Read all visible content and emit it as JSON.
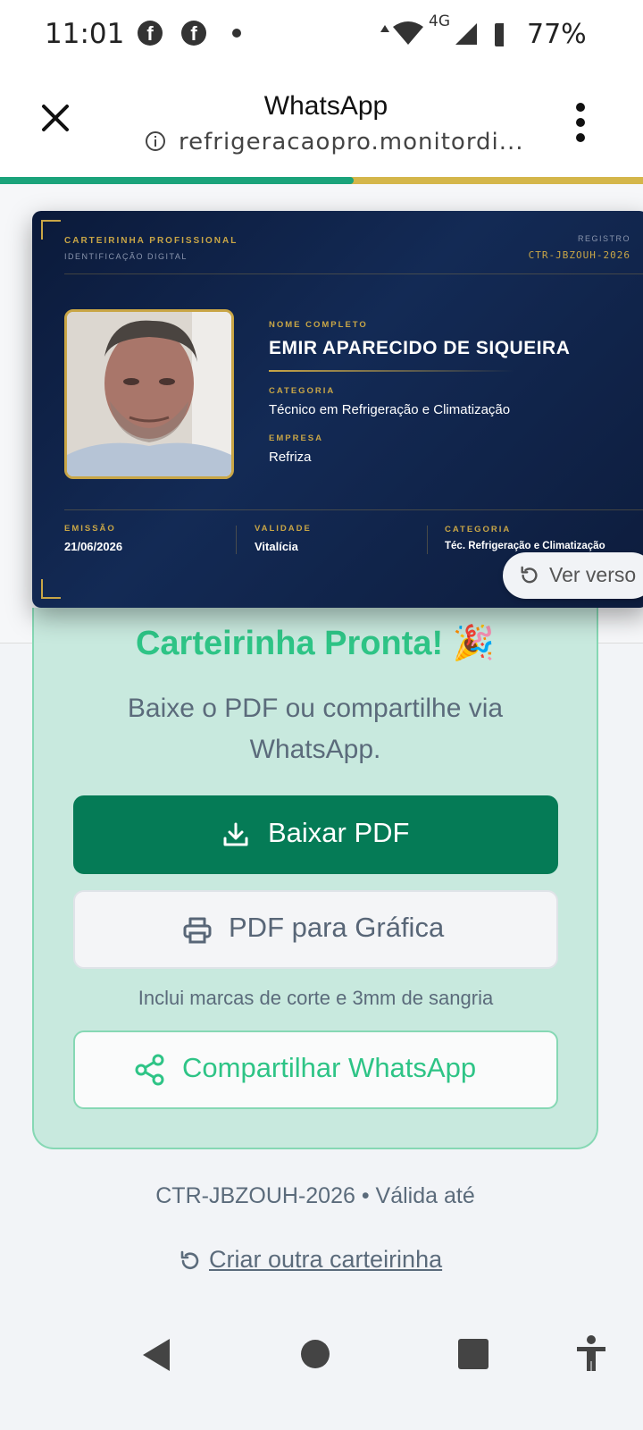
{
  "status_bar": {
    "time": "11:01",
    "network": "4G",
    "battery": "77%"
  },
  "tab": {
    "title": "WhatsApp",
    "url": "refrigeracaopro.monitordi..."
  },
  "page_load_progress": 0.55,
  "card": {
    "heading": "CARTEIRINHA PROFISSIONAL",
    "subheading": "IDENTIFICAÇÃO DIGITAL",
    "registro_label": "REGISTRO",
    "registro_value": "CTR-JBZOUH-2026",
    "nome_label": "NOME COMPLETO",
    "nome_value": "EMIR APARECIDO DE SIQUEIRA",
    "categoria_label": "CATEGORIA",
    "categoria_value": "Técnico em Refrigeração e Climatização",
    "empresa_label": "EMPRESA",
    "empresa_value": "Refriza",
    "emissao_label": "EMISSÃO",
    "emissao_value": "21/06/2026",
    "validade_label": "VALIDADE",
    "validade_value": "Vitalícia",
    "categoria2_label": "CATEGORIA",
    "categoria2_value": "Téc. Refrigeração e Climatização",
    "flip_label": "Ver verso"
  },
  "panel": {
    "title": "Carteirinha Pronta! 🎉",
    "subtitle": "Baixe o PDF ou compartilhe via WhatsApp.",
    "download_label": "Baixar PDF",
    "grafica_label": "PDF para Gráfica",
    "note": "Inclui marcas de corte e 3mm de sangria",
    "share_label": "Compartilhar WhatsApp"
  },
  "footer": {
    "code_line": "CTR-JBZOUH-2026 • Válida até",
    "recreate_label": "Criar outra carteirinha"
  },
  "colors": {
    "accent_green": "#057b56",
    "success_text": "#2ec486",
    "card_gold": "#c9a646",
    "card_navy": "#0b1a3a"
  }
}
